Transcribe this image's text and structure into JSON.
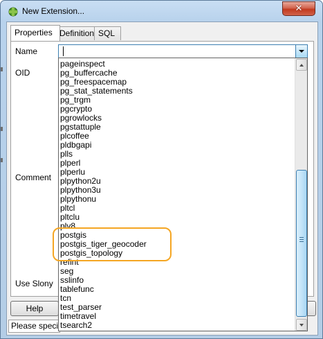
{
  "window": {
    "title": "New Extension...",
    "close_glyph": "✕"
  },
  "tabs": [
    {
      "label": "Properties",
      "active": true
    },
    {
      "label": "Definition",
      "active": false
    },
    {
      "label": "SQL",
      "active": false
    }
  ],
  "form": {
    "name_label": "Name",
    "oid_label": "OID",
    "comment_label": "Comment",
    "use_slony_label": "Use Slony",
    "name_value": ""
  },
  "dropdown_items": [
    "pageinspect",
    "pg_buffercache",
    "pg_freespacemap",
    "pg_stat_statements",
    "pg_trgm",
    "pgcrypto",
    "pgrowlocks",
    "pgstattuple",
    "plcoffee",
    "pldbgapi",
    "plls",
    "plperl",
    "plperlu",
    "plpython2u",
    "plpython3u",
    "plpythonu",
    "pltcl",
    "pltclu",
    "plv8",
    "postgis",
    "postgis_tiger_geocoder",
    "postgis_topology",
    "refint",
    "seg",
    "sslinfo",
    "tablefunc",
    "tcn",
    "test_parser",
    "timetravel",
    "tsearch2"
  ],
  "buttons": {
    "help": "Help"
  },
  "status_text": "Please specify",
  "colors": {
    "highlight": "#f5a623",
    "close_button": "#c23a1f",
    "focus_border": "#3c7fb1"
  },
  "icons": {
    "app": "elephant-extension-icon",
    "close": "close-icon",
    "combo_arrow": "chevron-down-icon"
  }
}
